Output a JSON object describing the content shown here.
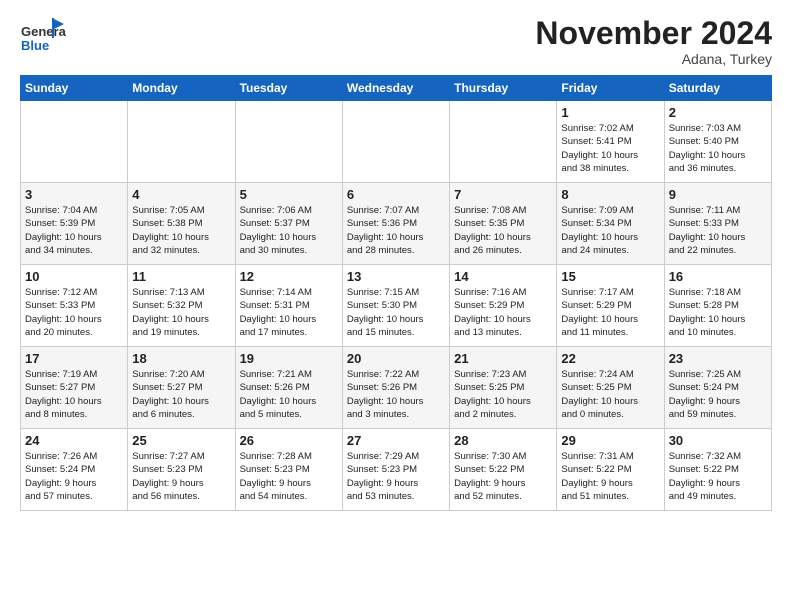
{
  "header": {
    "logo_general": "General",
    "logo_blue": "Blue",
    "month": "November 2024",
    "location": "Adana, Turkey"
  },
  "days_of_week": [
    "Sunday",
    "Monday",
    "Tuesday",
    "Wednesday",
    "Thursday",
    "Friday",
    "Saturday"
  ],
  "weeks": [
    [
      {
        "num": "",
        "info": ""
      },
      {
        "num": "",
        "info": ""
      },
      {
        "num": "",
        "info": ""
      },
      {
        "num": "",
        "info": ""
      },
      {
        "num": "",
        "info": ""
      },
      {
        "num": "1",
        "info": "Sunrise: 7:02 AM\nSunset: 5:41 PM\nDaylight: 10 hours\nand 38 minutes."
      },
      {
        "num": "2",
        "info": "Sunrise: 7:03 AM\nSunset: 5:40 PM\nDaylight: 10 hours\nand 36 minutes."
      }
    ],
    [
      {
        "num": "3",
        "info": "Sunrise: 7:04 AM\nSunset: 5:39 PM\nDaylight: 10 hours\nand 34 minutes."
      },
      {
        "num": "4",
        "info": "Sunrise: 7:05 AM\nSunset: 5:38 PM\nDaylight: 10 hours\nand 32 minutes."
      },
      {
        "num": "5",
        "info": "Sunrise: 7:06 AM\nSunset: 5:37 PM\nDaylight: 10 hours\nand 30 minutes."
      },
      {
        "num": "6",
        "info": "Sunrise: 7:07 AM\nSunset: 5:36 PM\nDaylight: 10 hours\nand 28 minutes."
      },
      {
        "num": "7",
        "info": "Sunrise: 7:08 AM\nSunset: 5:35 PM\nDaylight: 10 hours\nand 26 minutes."
      },
      {
        "num": "8",
        "info": "Sunrise: 7:09 AM\nSunset: 5:34 PM\nDaylight: 10 hours\nand 24 minutes."
      },
      {
        "num": "9",
        "info": "Sunrise: 7:11 AM\nSunset: 5:33 PM\nDaylight: 10 hours\nand 22 minutes."
      }
    ],
    [
      {
        "num": "10",
        "info": "Sunrise: 7:12 AM\nSunset: 5:33 PM\nDaylight: 10 hours\nand 20 minutes."
      },
      {
        "num": "11",
        "info": "Sunrise: 7:13 AM\nSunset: 5:32 PM\nDaylight: 10 hours\nand 19 minutes."
      },
      {
        "num": "12",
        "info": "Sunrise: 7:14 AM\nSunset: 5:31 PM\nDaylight: 10 hours\nand 17 minutes."
      },
      {
        "num": "13",
        "info": "Sunrise: 7:15 AM\nSunset: 5:30 PM\nDaylight: 10 hours\nand 15 minutes."
      },
      {
        "num": "14",
        "info": "Sunrise: 7:16 AM\nSunset: 5:29 PM\nDaylight: 10 hours\nand 13 minutes."
      },
      {
        "num": "15",
        "info": "Sunrise: 7:17 AM\nSunset: 5:29 PM\nDaylight: 10 hours\nand 11 minutes."
      },
      {
        "num": "16",
        "info": "Sunrise: 7:18 AM\nSunset: 5:28 PM\nDaylight: 10 hours\nand 10 minutes."
      }
    ],
    [
      {
        "num": "17",
        "info": "Sunrise: 7:19 AM\nSunset: 5:27 PM\nDaylight: 10 hours\nand 8 minutes."
      },
      {
        "num": "18",
        "info": "Sunrise: 7:20 AM\nSunset: 5:27 PM\nDaylight: 10 hours\nand 6 minutes."
      },
      {
        "num": "19",
        "info": "Sunrise: 7:21 AM\nSunset: 5:26 PM\nDaylight: 10 hours\nand 5 minutes."
      },
      {
        "num": "20",
        "info": "Sunrise: 7:22 AM\nSunset: 5:26 PM\nDaylight: 10 hours\nand 3 minutes."
      },
      {
        "num": "21",
        "info": "Sunrise: 7:23 AM\nSunset: 5:25 PM\nDaylight: 10 hours\nand 2 minutes."
      },
      {
        "num": "22",
        "info": "Sunrise: 7:24 AM\nSunset: 5:25 PM\nDaylight: 10 hours\nand 0 minutes."
      },
      {
        "num": "23",
        "info": "Sunrise: 7:25 AM\nSunset: 5:24 PM\nDaylight: 9 hours\nand 59 minutes."
      }
    ],
    [
      {
        "num": "24",
        "info": "Sunrise: 7:26 AM\nSunset: 5:24 PM\nDaylight: 9 hours\nand 57 minutes."
      },
      {
        "num": "25",
        "info": "Sunrise: 7:27 AM\nSunset: 5:23 PM\nDaylight: 9 hours\nand 56 minutes."
      },
      {
        "num": "26",
        "info": "Sunrise: 7:28 AM\nSunset: 5:23 PM\nDaylight: 9 hours\nand 54 minutes."
      },
      {
        "num": "27",
        "info": "Sunrise: 7:29 AM\nSunset: 5:23 PM\nDaylight: 9 hours\nand 53 minutes."
      },
      {
        "num": "28",
        "info": "Sunrise: 7:30 AM\nSunset: 5:22 PM\nDaylight: 9 hours\nand 52 minutes."
      },
      {
        "num": "29",
        "info": "Sunrise: 7:31 AM\nSunset: 5:22 PM\nDaylight: 9 hours\nand 51 minutes."
      },
      {
        "num": "30",
        "info": "Sunrise: 7:32 AM\nSunset: 5:22 PM\nDaylight: 9 hours\nand 49 minutes."
      }
    ]
  ]
}
